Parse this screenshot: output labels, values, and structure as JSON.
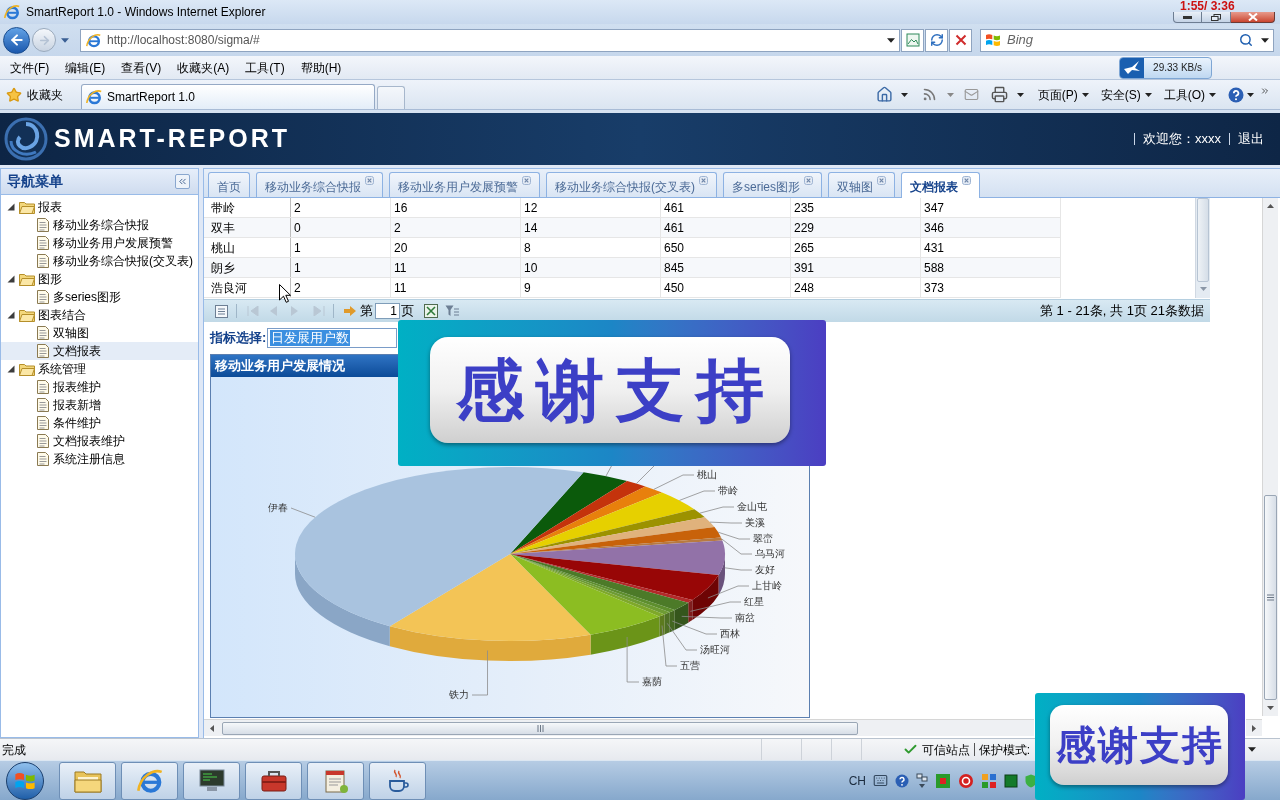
{
  "window": {
    "title": "SmartReport 1.0 - Windows Internet Explorer",
    "video_timer": "1:55/ 3:36"
  },
  "address_bar": {
    "url": "http://localhost:8080/sigma/#",
    "search_placeholder": "Bing"
  },
  "menu_bar": [
    "文件(F)",
    "编辑(E)",
    "查看(V)",
    "收藏夹(A)",
    "工具(T)",
    "帮助(H)"
  ],
  "download_speed": "29.33 KB/s",
  "favorites_bar": {
    "label": "收藏夹",
    "tabs": [
      {
        "title": "SmartReport 1.0",
        "selected": true
      }
    ]
  },
  "command_bar": [
    "页面(P)",
    "安全(S)",
    "工具(O)"
  ],
  "app_header": {
    "logo_text": "SMART-REPORT",
    "welcome": "欢迎您：xxxx",
    "logout": "退出"
  },
  "sidebar": {
    "title": "导航菜单",
    "items": [
      {
        "label": "报表",
        "expanded": true,
        "children": [
          {
            "label": "移动业务综合快报",
            "selected": false
          },
          {
            "label": "移动业务用户发展预警",
            "selected": false
          },
          {
            "label": "移动业务综合快报(交叉表)",
            "selected": false
          }
        ]
      },
      {
        "label": "图形",
        "expanded": true,
        "children": [
          {
            "label": "多series图形",
            "selected": false
          }
        ]
      },
      {
        "label": "图表结合",
        "expanded": true,
        "children": [
          {
            "label": "双轴图",
            "selected": false
          },
          {
            "label": "文档报表",
            "selected": true
          }
        ]
      },
      {
        "label": "系统管理",
        "expanded": true,
        "children": [
          {
            "label": "报表维护",
            "selected": false
          },
          {
            "label": "报表新增",
            "selected": false
          },
          {
            "label": "条件维护",
            "selected": false
          },
          {
            "label": "文档报表维护",
            "selected": false
          },
          {
            "label": "系统注册信息",
            "selected": false
          }
        ]
      }
    ]
  },
  "tabs": [
    {
      "label": "首页",
      "closable": false,
      "selected": false
    },
    {
      "label": "移动业务综合快报",
      "closable": true,
      "selected": false
    },
    {
      "label": "移动业务用户发展预警",
      "closable": true,
      "selected": false
    },
    {
      "label": "移动业务综合快报(交叉表)",
      "closable": true,
      "selected": false
    },
    {
      "label": "多series图形",
      "closable": true,
      "selected": false
    },
    {
      "label": "双轴图",
      "closable": true,
      "selected": false
    },
    {
      "label": "文档报表",
      "closable": true,
      "selected": true
    }
  ],
  "table": {
    "rows": [
      [
        "带岭",
        "2",
        "16",
        "12",
        "461",
        "235",
        "347"
      ],
      [
        "双丰",
        "0",
        "2",
        "14",
        "461",
        "229",
        "346"
      ],
      [
        "桃山",
        "1",
        "20",
        "8",
        "650",
        "265",
        "431"
      ],
      [
        "朗乡",
        "1",
        "11",
        "10",
        "845",
        "391",
        "588"
      ],
      [
        "浩良河",
        "2",
        "11",
        "9",
        "450",
        "248",
        "373"
      ]
    ]
  },
  "pager": {
    "navigation_disabled": true,
    "page_prefix": "第",
    "page": "1",
    "page_suffix": "页",
    "summary": "第 1 - 21条, 共 1页 21条数据"
  },
  "indicator": {
    "label": "指标选择:",
    "value": "日发展用户数"
  },
  "chart_panel": {
    "title": "移动业务用户发展情况",
    "slice_labels": [
      "桃山",
      "带岭",
      "金山屯",
      "美溪",
      "翠峦",
      "乌马河",
      "友好",
      "上甘岭",
      "红星",
      "南岔",
      "西林",
      "汤旺河",
      "五营",
      "嘉荫",
      "铁力",
      "伊春"
    ]
  },
  "status_bar": {
    "text": "完成",
    "zone": "可信站点",
    "protected_mode": "保护模式:"
  },
  "taskbar": {
    "language": "CH"
  },
  "overlays": [
    {
      "text": "感谢支持"
    },
    {
      "text": "感谢支持"
    }
  ]
}
